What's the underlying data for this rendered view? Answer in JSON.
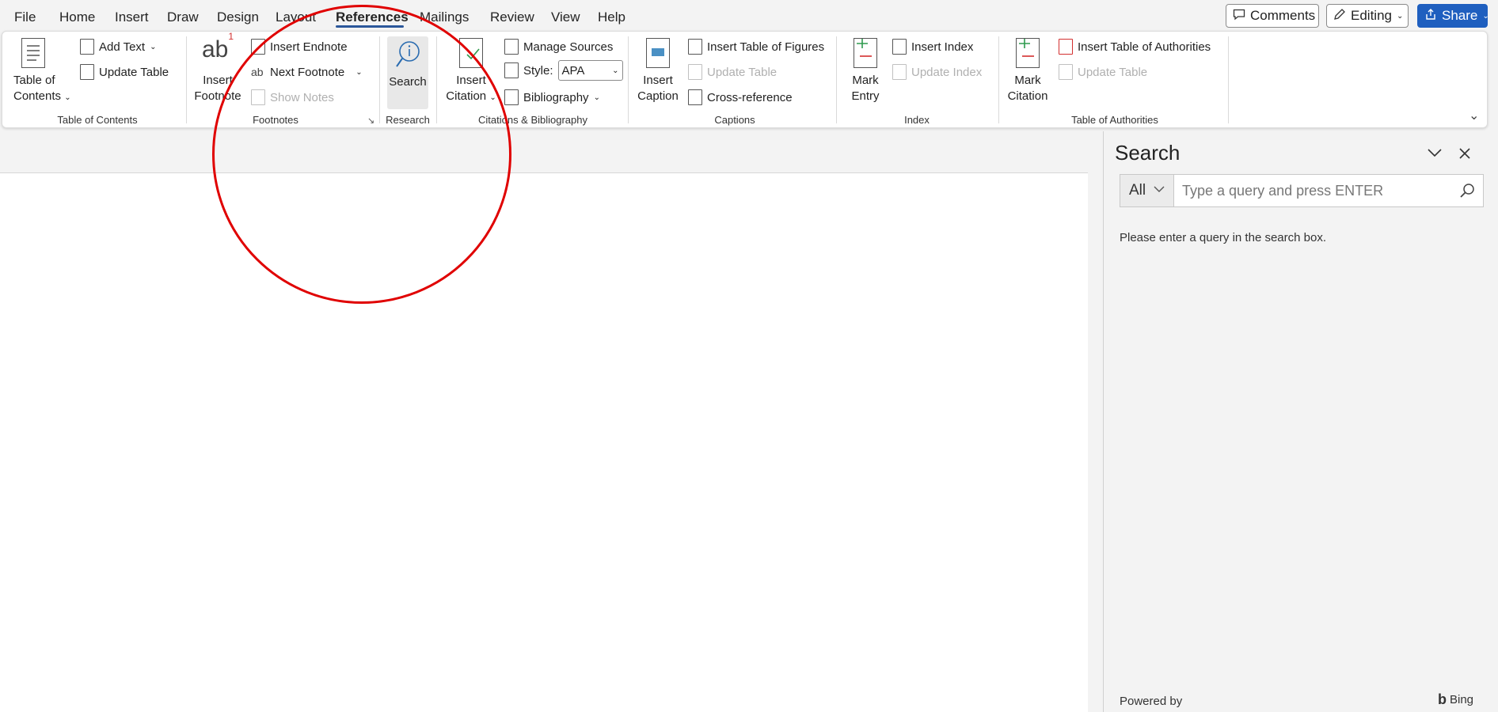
{
  "menu": {
    "items": [
      "File",
      "Home",
      "Insert",
      "Draw",
      "Design",
      "Layout",
      "References",
      "Mailings",
      "Review",
      "View",
      "Help"
    ],
    "active": "References"
  },
  "top_buttons": {
    "comments": "Comments",
    "editing": "Editing",
    "share": "Share"
  },
  "ribbon": {
    "toc": {
      "big": [
        "Table of",
        "Contents"
      ],
      "add_text": "Add Text",
      "update_table": "Update Table",
      "group": "Table of Contents"
    },
    "footnotes": {
      "big": [
        "Insert",
        "Footnote"
      ],
      "big_icon_text": "ab",
      "big_icon_sup": "1",
      "insert_endnote": "Insert Endnote",
      "next_footnote": "Next Footnote",
      "show_notes": "Show Notes",
      "group": "Footnotes"
    },
    "research": {
      "search": "Search",
      "group": "Research"
    },
    "citations": {
      "big": [
        "Insert",
        "Citation"
      ],
      "manage_sources": "Manage Sources",
      "style_label": "Style:",
      "style_value": "APA",
      "bibliography": "Bibliography",
      "group": "Citations & Bibliography"
    },
    "captions": {
      "big": [
        "Insert",
        "Caption"
      ],
      "insert_tof": "Insert Table of Figures",
      "update_table": "Update Table",
      "cross_reference": "Cross-reference",
      "group": "Captions"
    },
    "index": {
      "big": [
        "Mark",
        "Entry"
      ],
      "insert_index": "Insert Index",
      "update_index": "Update Index",
      "group": "Index"
    },
    "authorities": {
      "big": [
        "Mark",
        "Citation"
      ],
      "insert_toa": "Insert Table of Authorities",
      "update_table": "Update Table",
      "group": "Table of Authorities"
    }
  },
  "search_pane": {
    "title": "Search",
    "scope": "All",
    "placeholder": "Type a query and press ENTER",
    "message": "Please enter a query in the search box.",
    "powered_by": "Powered by",
    "provider": "Bing"
  },
  "colors": {
    "accent": "#2b579a",
    "share": "#1f5fbf",
    "annotation": "#e00000"
  }
}
